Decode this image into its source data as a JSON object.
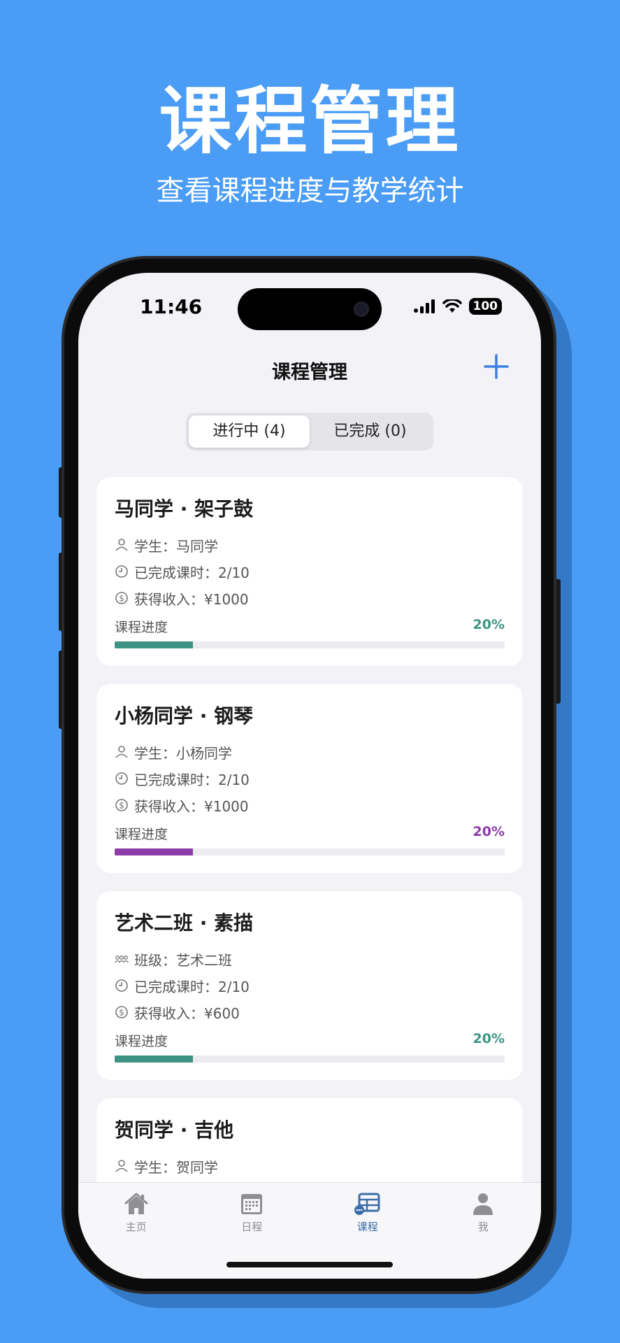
{
  "promo": {
    "title": "课程管理",
    "subtitle": "查看课程进度与教学统计"
  },
  "status_bar": {
    "time": "11:46",
    "battery": "100"
  },
  "nav": {
    "title": "课程管理",
    "add_icon": "plus-icon"
  },
  "segment": {
    "active": "进行中 (4)",
    "inactive": "已完成 (0)"
  },
  "courses": [
    {
      "title": "马同学 · 架子鼓",
      "who": "学生：马同学",
      "who_icon": "person-icon",
      "lessons": "已完成课时：2/10",
      "income": "获得收入：¥1000",
      "progress_label": "课程进度",
      "progress_text": "20%",
      "progress": 0.2,
      "color": "#3e9483"
    },
    {
      "title": "小杨同学 · 钢琴",
      "who": "学生：小杨同学",
      "who_icon": "person-icon",
      "lessons": "已完成课时：2/10",
      "income": "获得收入：¥1000",
      "progress_label": "课程进度",
      "progress_text": "20%",
      "progress": 0.2,
      "color": "#8d3ba8"
    },
    {
      "title": "艺术二班 · 素描",
      "who": "班级：艺术二班",
      "who_icon": "group-icon",
      "lessons": "已完成课时：2/10",
      "income": "获得收入：¥600",
      "progress_label": "课程进度",
      "progress_text": "20%",
      "progress": 0.2,
      "color": "#3e9483"
    },
    {
      "title": "贺同学 · 吉他",
      "who": "学生：贺同学",
      "who_icon": "person-icon"
    }
  ],
  "tabs": [
    {
      "label": "主页",
      "icon": "home-icon"
    },
    {
      "label": "日程",
      "icon": "calendar-icon"
    },
    {
      "label": "课程",
      "icon": "course-icon",
      "active": true
    },
    {
      "label": "我",
      "icon": "profile-icon"
    }
  ],
  "colors": {
    "background": "#4a9cf4",
    "accent": "#3b7fe0",
    "tab_active": "#3b6ea8"
  }
}
